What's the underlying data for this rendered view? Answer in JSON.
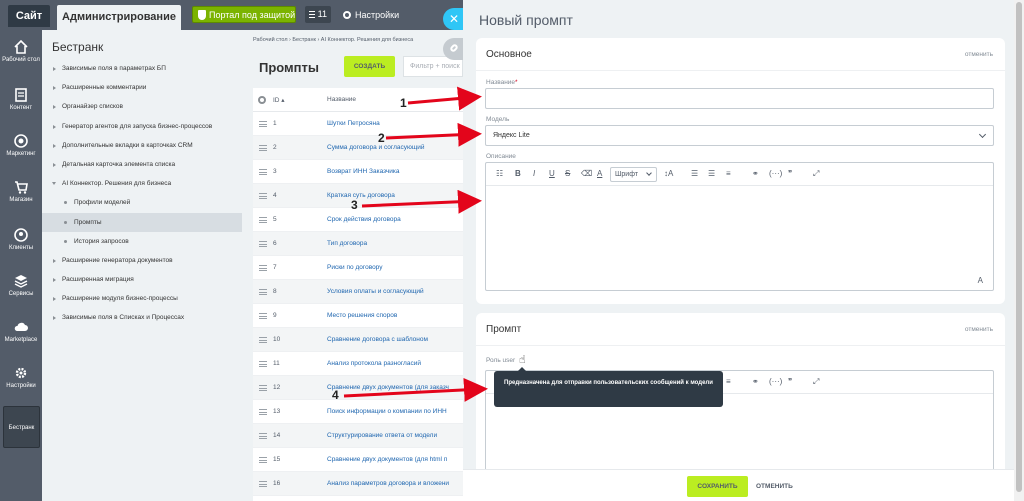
{
  "topbar": {
    "site_tab": "Сайт",
    "admin_tab": "Администрирование",
    "portal_button": "Портал под защитой",
    "count": "11",
    "settings": "Настройки"
  },
  "leftbar": [
    {
      "label": "Рабочий стол",
      "icon": "home-icon"
    },
    {
      "label": "Контент",
      "icon": "document-icon"
    },
    {
      "label": "Маркетинг",
      "icon": "target-icon"
    },
    {
      "label": "Магазин",
      "icon": "cart-icon"
    },
    {
      "label": "Клиенты",
      "icon": "users-icon"
    },
    {
      "label": "Сервисы",
      "icon": "layers-icon"
    },
    {
      "label": "Marketplace",
      "icon": "cloud-icon"
    },
    {
      "label": "Настройки",
      "icon": "gear-icon"
    },
    {
      "label": "Бестранк",
      "icon": ""
    }
  ],
  "tree": {
    "title": "Бестранк",
    "items": [
      "Зависимые поля в параметрах БП",
      "Расширенные комментарии",
      "Органайзер списков",
      "Генератор агентов для запуска бизнес-процессов",
      "Дополнительные вкладки в карточках CRM",
      "Детальная карточка элемента списка",
      "AI Коннектор. Решения для бизнеса",
      "Профили моделей",
      "Промпты",
      "История запросов",
      "Расширение генератора документов",
      "Расширенная миграция",
      "Расширение модуля бизнес-процессы",
      "Зависимые поля в Списках и Процессах"
    ]
  },
  "main": {
    "breadcrumbs": "Рабочий стол  ›  Бестранк  ›  AI Коннектор. Решения для бизнеса",
    "title": "Промпты",
    "create_button": "СОЗДАТЬ",
    "filter_placeholder": "Фильтр + поиск",
    "columns": {
      "id": "ID",
      "name": "Название"
    },
    "rows": [
      {
        "id": "1",
        "name": "Шутки Петросяна"
      },
      {
        "id": "2",
        "name": "Сумма договора и согласующий"
      },
      {
        "id": "3",
        "name": "Возврат ИНН Заказчика"
      },
      {
        "id": "4",
        "name": "Краткая суть договора"
      },
      {
        "id": "5",
        "name": "Срок действия договора"
      },
      {
        "id": "6",
        "name": "Тип договора"
      },
      {
        "id": "7",
        "name": "Риски по договору"
      },
      {
        "id": "8",
        "name": "Условия оплаты и согласующий"
      },
      {
        "id": "9",
        "name": "Место решения споров"
      },
      {
        "id": "10",
        "name": "Сравнение договора с шаблоном"
      },
      {
        "id": "11",
        "name": "Анализ протокола разногласий"
      },
      {
        "id": "12",
        "name": "Сравнение двух документов (для заказч"
      },
      {
        "id": "13",
        "name": "Поиск информации о компании по ИНН"
      },
      {
        "id": "14",
        "name": "Структурирование ответа от модели"
      },
      {
        "id": "15",
        "name": "Сравнение двух документов (для html п"
      },
      {
        "id": "16",
        "name": "Анализ параметров договора и вложени"
      }
    ]
  },
  "slider": {
    "title": "Новый промпт",
    "section_basic": "Основное",
    "section_prompt": "Промпт",
    "cancel_link": "отменить",
    "name_label": "Название",
    "name_value": "",
    "model_label": "Модель",
    "model_value": "Яндекс Lite",
    "description_label": "Описание",
    "font_label": "Шрифт",
    "role_label": "Роль user",
    "tooltip": "Предназначена для отправки пользовательских сообщений к модели",
    "save_button": "СОХРАНИТЬ",
    "cancel_button": "ОТМЕНИТЬ"
  },
  "annotations": [
    "1",
    "2",
    "3",
    "4"
  ],
  "colors": {
    "accent_green": "#bbed21",
    "arrow_red": "#e3051b",
    "close_blue": "#2fc6f6",
    "sidebar": "#535c69"
  }
}
